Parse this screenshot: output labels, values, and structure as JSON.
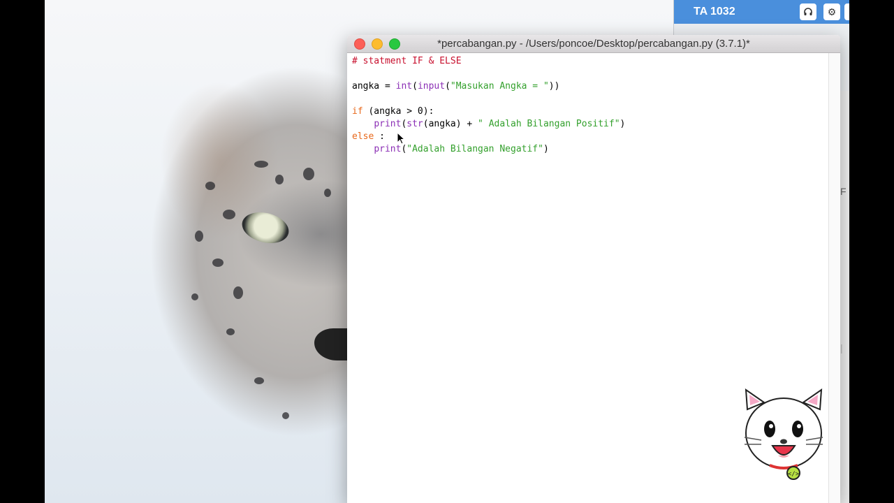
{
  "back_window": {
    "title": "TA 1032",
    "buttons": [
      "headphones-icon",
      "gear-icon",
      "camera-icon"
    ],
    "side_letter": "F"
  },
  "editor": {
    "title": "*percabangan.py - /Users/poncoe/Desktop/percabangan.py (3.7.1)*",
    "code": {
      "comment": "# statment IF & ELSE",
      "l2_var": "angka = ",
      "l2_int": "int",
      "l2_paren": "(",
      "l2_input": "input",
      "l2_open": "(",
      "l2_str": "\"Masukan Angka = \"",
      "l2_close": "))",
      "l3_if": "if",
      "l3_rest": " (angka > 0):",
      "l4_indent": "    ",
      "l4_print": "print",
      "l4_open": "(",
      "l4_str_fn": "str",
      "l4_mid": "(angka) + ",
      "l4_str": "\" Adalah Bilangan Positif\"",
      "l4_close": ")",
      "l5_else": "else",
      "l5_rest": " :",
      "l6_indent": "    ",
      "l6_print": "print",
      "l6_open": "(",
      "l6_str": "\"Adalah Bilangan Negatif\"",
      "l6_close": ")"
    }
  },
  "colors": {
    "comment": "#c8102e",
    "keyword": "#e8691c",
    "builtin": "#8b2fb5",
    "string": "#33a02c",
    "accent_blue": "#4a8fdc"
  },
  "mascot_icon": "cat-mascot-icon"
}
